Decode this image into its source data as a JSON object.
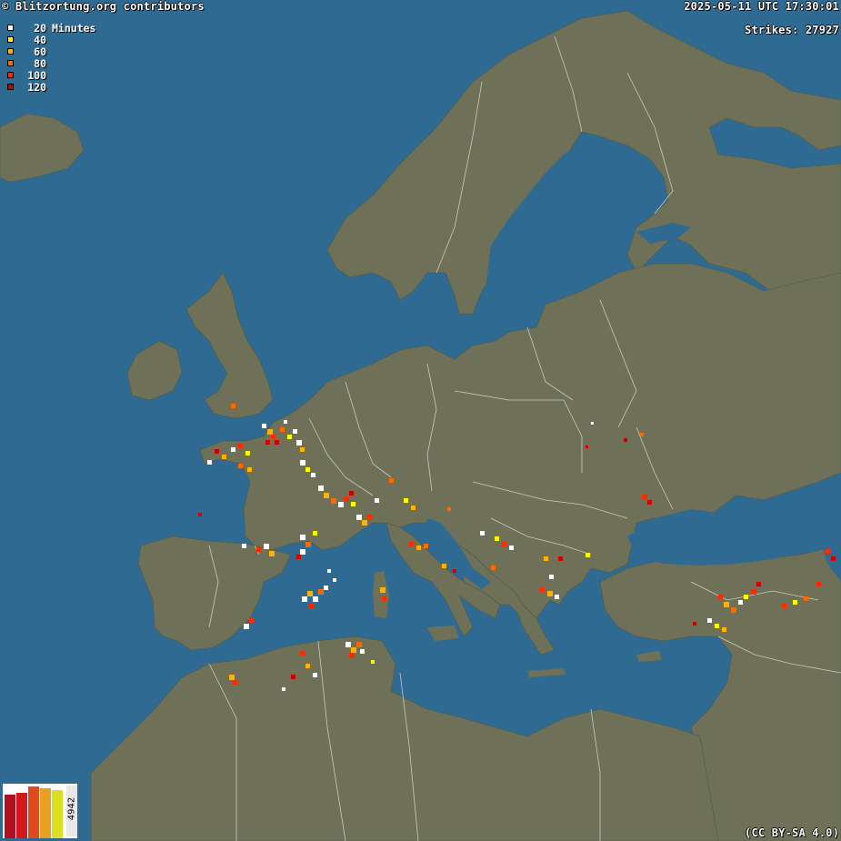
{
  "header": {
    "credit": "© Blitzortung.org contributors",
    "datetime": "2025-05-11 UTC 17:30:01",
    "strikes_label": "Strikes: 27927"
  },
  "legend": {
    "unit": "Minutes",
    "items": [
      {
        "label": "20",
        "color": "#ffffff"
      },
      {
        "label": "40",
        "color": "#ffff00"
      },
      {
        "label": "60",
        "color": "#ffb300"
      },
      {
        "label": "80",
        "color": "#ff6a00"
      },
      {
        "label": "100",
        "color": "#ff2a00"
      },
      {
        "label": "120",
        "color": "#cc0000"
      }
    ]
  },
  "histogram": {
    "count": "4942",
    "bars": [
      {
        "value": 0.82,
        "color": "#b01020"
      },
      {
        "value": 0.86,
        "color": "#d2181c"
      },
      {
        "value": 0.98,
        "color": "#e04a1c"
      },
      {
        "value": 0.95,
        "color": "#e8a020"
      },
      {
        "value": 0.91,
        "color": "#dce020"
      }
    ]
  },
  "license": "(CC BY-SA 4.0)",
  "colors": {
    "sea": "#2f6a93",
    "land": "#6e7158",
    "border": "#d8d8d8",
    "river": "#5a8aa8"
  }
}
